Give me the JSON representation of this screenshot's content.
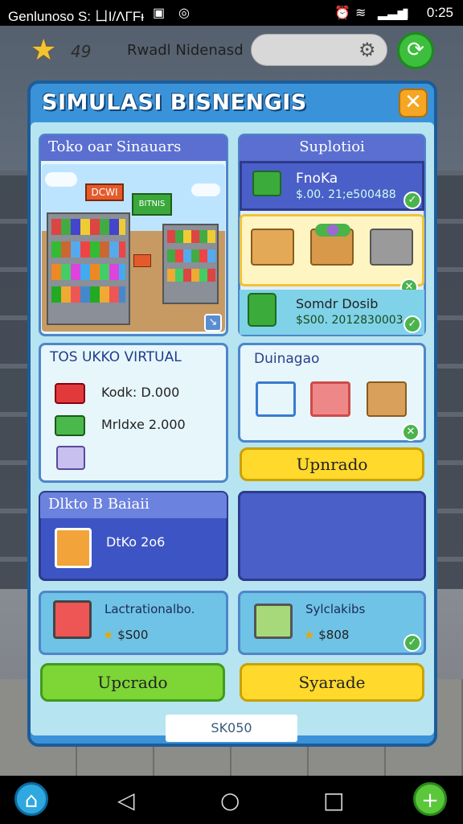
{
  "status_bar": {
    "left": "Genlunoso S: ㄩI/ΛΓFᵻ",
    "time": "0:25"
  },
  "top_bar": {
    "level": "49",
    "player_name": "Rwadl Nidenasd"
  },
  "panel": {
    "title": "SIMULASI BISNENGIS"
  },
  "store_card": {
    "title": "Toko oar Sinauars",
    "sign1": "DCWI",
    "sign2": "BITNIS"
  },
  "supplier_card": {
    "title": "Suplotioi",
    "item1": {
      "name": "FnoKa",
      "price": "$.00. 21;e500488"
    },
    "item2": {
      "name": "Somdr Dosib",
      "price": "$S00. 2012830003"
    }
  },
  "virtual_card": {
    "title": "TOS UKKO VIRTUAL",
    "rows": [
      {
        "label": "Kodk: D.000"
      },
      {
        "label": "Mrldxe 2.000"
      },
      {
        "label": ""
      }
    ]
  },
  "dunnage_card": {
    "title": "Duinagao"
  },
  "upgrade_button_top": "Upnrado",
  "daily_card": {
    "title": "Dlkto B Baiaii",
    "item": "DtKo 2o6"
  },
  "bottom_row": {
    "left": {
      "title": "Lactrationalbo.",
      "price": "$S00"
    },
    "right": {
      "title": "Sylclakibs",
      "price": "$808"
    }
  },
  "buttons": {
    "left": "Upcrado",
    "right": "Syarade"
  },
  "footer_label": "SK050",
  "colors": {
    "panel": "#3a93d8",
    "header": "#5a6fd0",
    "yellow": "#ffd92b",
    "green": "#7ed536"
  }
}
